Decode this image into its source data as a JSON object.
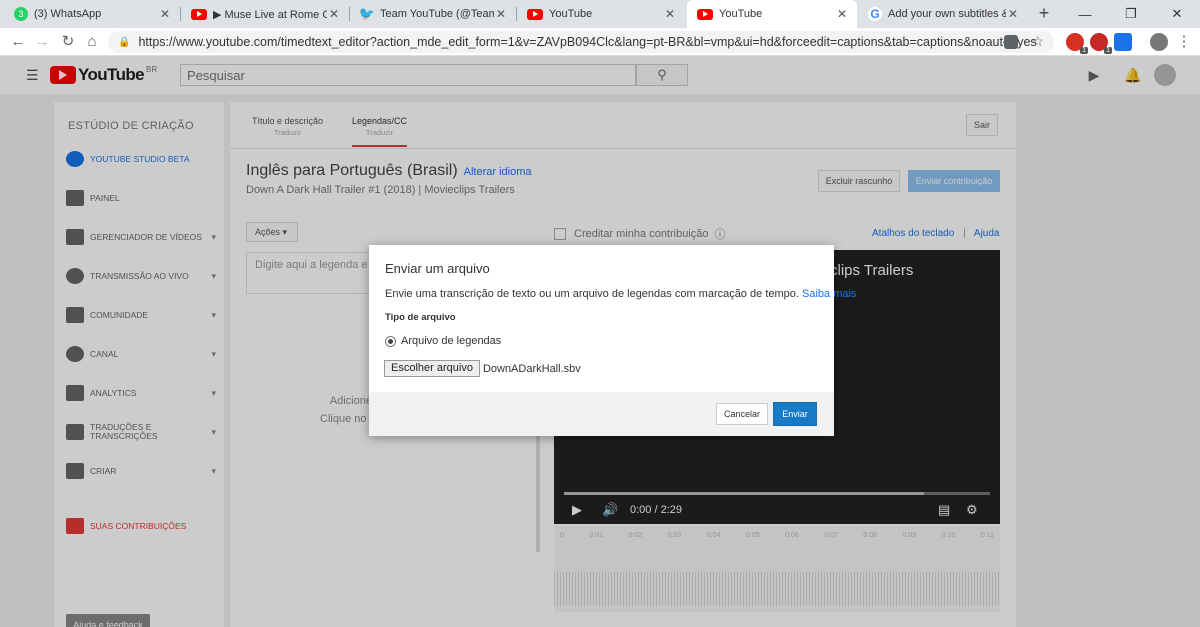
{
  "browser": {
    "tabs": [
      {
        "title": "(3) WhatsApp",
        "favicon": "whatsapp-icon",
        "badge": "3"
      },
      {
        "title": "▶ Muse Live at Rome Olymp",
        "favicon": "youtube-icon"
      },
      {
        "title": "Team YouTube (@TeamYouTu",
        "favicon": "twitter-icon"
      },
      {
        "title": "YouTube",
        "favicon": "youtube-icon"
      },
      {
        "title": "YouTube",
        "favicon": "youtube-icon",
        "active": true
      },
      {
        "title": "Add your own subtitles & clo",
        "favicon": "google-icon"
      }
    ],
    "url": "https://www.youtube.com/timedtext_editor?action_mde_edit_form=1&v=ZAVpB094Clc&lang=pt-BR&bl=vmp&ui=hd&forceedit=captions&tab=captions&noauto=yes",
    "extension_badges": [
      "1",
      "1"
    ]
  },
  "youtube": {
    "logo_word": "YouTube",
    "logo_region": "BR",
    "search_placeholder": "Pesquisar"
  },
  "sidebar": {
    "heading": "ESTÚDIO DE CRIAÇÃO",
    "items": [
      {
        "label": "YOUTUBE STUDIO BETA",
        "icon": "gear-icon"
      },
      {
        "label": "PAINEL",
        "icon": "dashboard-icon"
      },
      {
        "label": "GERENCIADOR DE VÍDEOS",
        "icon": "video-manager-icon"
      },
      {
        "label": "TRANSMISSÃO AO VIVO",
        "icon": "live-icon"
      },
      {
        "label": "COMUNIDADE",
        "icon": "community-icon"
      },
      {
        "label": "CANAL",
        "icon": "channel-icon"
      },
      {
        "label": "ANALYTICS",
        "icon": "analytics-icon"
      },
      {
        "label": "TRADUÇÕES E TRANSCRIÇÕES",
        "icon": "translate-icon"
      },
      {
        "label": "CRIAR",
        "icon": "create-icon"
      },
      {
        "label": "SUAS CONTRIBUIÇÕES",
        "icon": "contributions-icon"
      }
    ],
    "feedback_label": "Ajuda e feedback"
  },
  "editor": {
    "tabs": [
      {
        "label": "Título e descrição",
        "sub": "Traduzir"
      },
      {
        "label": "Legendas/CC",
        "sub": "Traduzir"
      }
    ],
    "exit_label": "Sair",
    "language_title": "Inglês para Português (Brasil)",
    "change_language_link": "Alterar idioma",
    "video_title": "Down A Dark Hall Trailer #1 (2018) | Movieclips Trailers",
    "discard_label": "Excluir rascunho",
    "submit_label": "Enviar contribuição",
    "actions_label": "Ações",
    "caption_placeholder": "Digite aqui a legenda e pr",
    "credit_label": "Creditar minha contribuição",
    "shortcuts_link": "Atalhos do teclado",
    "help_link": "Ajuda",
    "add_hint_line1": "Adicione s",
    "add_hint_line2": "Clique no cam",
    "player_title_fragment": "clips Trailers",
    "player_time": "0:00 / 2:29",
    "timeline_ticks": [
      "0",
      "0:01",
      "0:02",
      "0:03",
      "0:04",
      "0:05",
      "0:06",
      "0:07",
      "0:08",
      "0:09",
      "0:10",
      "0:11"
    ]
  },
  "dialog": {
    "title": "Enviar um arquivo",
    "description": "Envie uma transcrição de texto ou um arquivo de legendas com marcação de tempo.",
    "learn_more": "Saiba mais",
    "file_type_label": "Tipo de arquivo",
    "option_label": "Arquivo de legendas",
    "choose_file_label": "Escolher arquivo",
    "file_name": "DownADarkHall.sbv",
    "cancel_label": "Cancelar",
    "send_label": "Enviar"
  }
}
